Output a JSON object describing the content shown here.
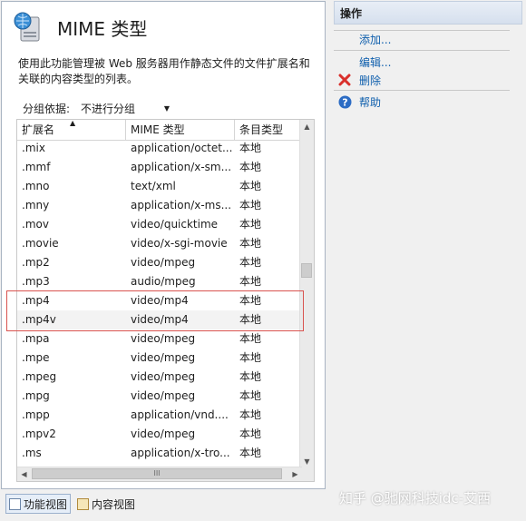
{
  "page": {
    "title": "MIME 类型",
    "description": "使用此功能管理被 Web 服务器用作静态文件的文件扩展名和关联的内容类型的列表。"
  },
  "group_by": {
    "label": "分组依据:",
    "value": "不进行分组"
  },
  "columns": [
    "扩展名",
    "MIME 类型",
    "条目类型"
  ],
  "rows": [
    {
      "ext": ".mix",
      "mime": "application/octet...",
      "type": "本地"
    },
    {
      "ext": ".mmf",
      "mime": "application/x-sm...",
      "type": "本地"
    },
    {
      "ext": ".mno",
      "mime": "text/xml",
      "type": "本地"
    },
    {
      "ext": ".mny",
      "mime": "application/x-ms...",
      "type": "本地"
    },
    {
      "ext": ".mov",
      "mime": "video/quicktime",
      "type": "本地"
    },
    {
      "ext": ".movie",
      "mime": "video/x-sgi-movie",
      "type": "本地"
    },
    {
      "ext": ".mp2",
      "mime": "video/mpeg",
      "type": "本地"
    },
    {
      "ext": ".mp3",
      "mime": "audio/mpeg",
      "type": "本地"
    },
    {
      "ext": ".mp4",
      "mime": "video/mp4",
      "type": "本地"
    },
    {
      "ext": ".mp4v",
      "mime": "video/mp4",
      "type": "本地"
    },
    {
      "ext": ".mpa",
      "mime": "video/mpeg",
      "type": "本地"
    },
    {
      "ext": ".mpe",
      "mime": "video/mpeg",
      "type": "本地"
    },
    {
      "ext": ".mpeg",
      "mime": "video/mpeg",
      "type": "本地"
    },
    {
      "ext": ".mpg",
      "mime": "video/mpeg",
      "type": "本地"
    },
    {
      "ext": ".mpp",
      "mime": "application/vnd....",
      "type": "本地"
    },
    {
      "ext": ".mpv2",
      "mime": "video/mpeg",
      "type": "本地"
    },
    {
      "ext": ".ms",
      "mime": "application/x-tro...",
      "type": "本地"
    }
  ],
  "bottom_tabs": {
    "features_view": "功能视图",
    "content_view": "内容视图"
  },
  "actions": {
    "header": "操作",
    "add": "添加...",
    "edit": "编辑...",
    "delete": "删除",
    "help": "帮助"
  },
  "scrollbar": {
    "h_thumb_grip": "III"
  },
  "watermark": "知乎 @驰网科技idc-艾西",
  "colors": {
    "link": "#0f5fad",
    "highlight_border": "#d9534f",
    "delete_icon": "#d9302c",
    "help_icon": "#2c6cc4"
  }
}
